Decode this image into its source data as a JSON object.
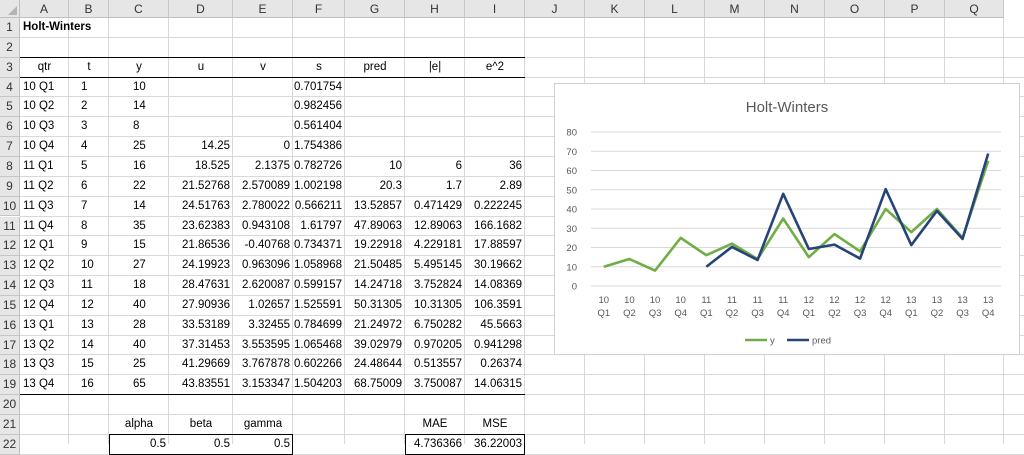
{
  "columns": [
    "A",
    "B",
    "C",
    "D",
    "E",
    "F",
    "G",
    "H",
    "I",
    "J",
    "K",
    "L",
    "M",
    "N",
    "O",
    "P",
    "Q"
  ],
  "rows": [
    "1",
    "2",
    "3",
    "4",
    "5",
    "6",
    "7",
    "8",
    "9",
    "10",
    "11",
    "12",
    "13",
    "14",
    "15",
    "16",
    "17",
    "18",
    "19",
    "20",
    "21",
    "22"
  ],
  "title": "Holt-Winters",
  "table_headers": [
    "qtr",
    "t",
    "y",
    "u",
    "v",
    "s",
    "pred",
    "|e|",
    "e^2"
  ],
  "table_rows": [
    [
      "10 Q1",
      "1",
      "10",
      "",
      "",
      "0.701754",
      "",
      "",
      ""
    ],
    [
      "10 Q2",
      "2",
      "14",
      "",
      "",
      "0.982456",
      "",
      "",
      ""
    ],
    [
      "10 Q3",
      "3",
      "8",
      "",
      "",
      "0.561404",
      "",
      "",
      ""
    ],
    [
      "10 Q4",
      "4",
      "25",
      "14.25",
      "0",
      "1.754386",
      "",
      "",
      ""
    ],
    [
      "11 Q1",
      "5",
      "16",
      "18.525",
      "2.1375",
      "0.782726",
      "10",
      "6",
      "36"
    ],
    [
      "11 Q2",
      "6",
      "22",
      "21.52768",
      "2.570089",
      "1.002198",
      "20.3",
      "1.7",
      "2.89"
    ],
    [
      "11 Q3",
      "7",
      "14",
      "24.51763",
      "2.780022",
      "0.566211",
      "13.52857",
      "0.471429",
      "0.222245"
    ],
    [
      "11 Q4",
      "8",
      "35",
      "23.62383",
      "0.943108",
      "1.61797",
      "47.89063",
      "12.89063",
      "166.1682"
    ],
    [
      "12 Q1",
      "9",
      "15",
      "21.86536",
      "-0.40768",
      "0.734371",
      "19.22918",
      "4.229181",
      "17.88597"
    ],
    [
      "12 Q2",
      "10",
      "27",
      "24.19923",
      "0.963096",
      "1.058968",
      "21.50485",
      "5.495145",
      "30.19662"
    ],
    [
      "12 Q3",
      "11",
      "18",
      "28.47631",
      "2.620087",
      "0.599157",
      "14.24718",
      "3.752824",
      "14.08369"
    ],
    [
      "12 Q4",
      "12",
      "40",
      "27.90936",
      "1.02657",
      "1.525591",
      "50.31305",
      "10.31305",
      "106.3591"
    ],
    [
      "13 Q1",
      "13",
      "28",
      "33.53189",
      "3.32455",
      "0.784699",
      "21.24972",
      "6.750282",
      "45.5663"
    ],
    [
      "13 Q2",
      "14",
      "40",
      "37.31453",
      "3.553595",
      "1.065468",
      "39.02979",
      "0.970205",
      "0.941298"
    ],
    [
      "13 Q3",
      "15",
      "25",
      "41.29669",
      "3.767878",
      "0.602266",
      "24.48644",
      "0.513557",
      "0.26374"
    ],
    [
      "13 Q4",
      "16",
      "65",
      "43.83551",
      "3.153347",
      "1.504203",
      "68.75009",
      "3.750087",
      "14.06315"
    ]
  ],
  "params": {
    "alpha_label": "alpha",
    "beta_label": "beta",
    "gamma_label": "gamma",
    "alpha": "0.5",
    "beta": "0.5",
    "gamma": "0.5"
  },
  "errors": {
    "mae_label": "MAE",
    "mse_label": "MSE",
    "mae": "4.736366",
    "mse": "36.22003"
  },
  "colors": {
    "y": "#70ad47",
    "pred": "#264478"
  },
  "chart_data": {
    "type": "line",
    "title": "Holt-Winters",
    "categories": [
      [
        "10",
        "Q1"
      ],
      [
        "10",
        "Q2"
      ],
      [
        "10",
        "Q3"
      ],
      [
        "10",
        "Q4"
      ],
      [
        "11",
        "Q1"
      ],
      [
        "11",
        "Q2"
      ],
      [
        "11",
        "Q3"
      ],
      [
        "11",
        "Q4"
      ],
      [
        "12",
        "Q1"
      ],
      [
        "12",
        "Q2"
      ],
      [
        "12",
        "Q3"
      ],
      [
        "12",
        "Q4"
      ],
      [
        "13",
        "Q1"
      ],
      [
        "13",
        "Q2"
      ],
      [
        "13",
        "Q3"
      ],
      [
        "13",
        "Q4"
      ]
    ],
    "series": [
      {
        "name": "y",
        "values": [
          10,
          14,
          8,
          25,
          16,
          22,
          14,
          35,
          15,
          27,
          18,
          40,
          28,
          40,
          25,
          65
        ]
      },
      {
        "name": "pred",
        "values": [
          null,
          null,
          null,
          null,
          10,
          20.3,
          13.52857,
          47.89063,
          19.22918,
          21.50485,
          14.24718,
          50.31305,
          21.24972,
          39.02979,
          24.48644,
          68.75009
        ]
      }
    ],
    "ylim": [
      0,
      80
    ],
    "yticks": [
      "0",
      "10",
      "20",
      "30",
      "40",
      "50",
      "60",
      "70",
      "80"
    ],
    "grid": true,
    "legend": "bottom"
  }
}
